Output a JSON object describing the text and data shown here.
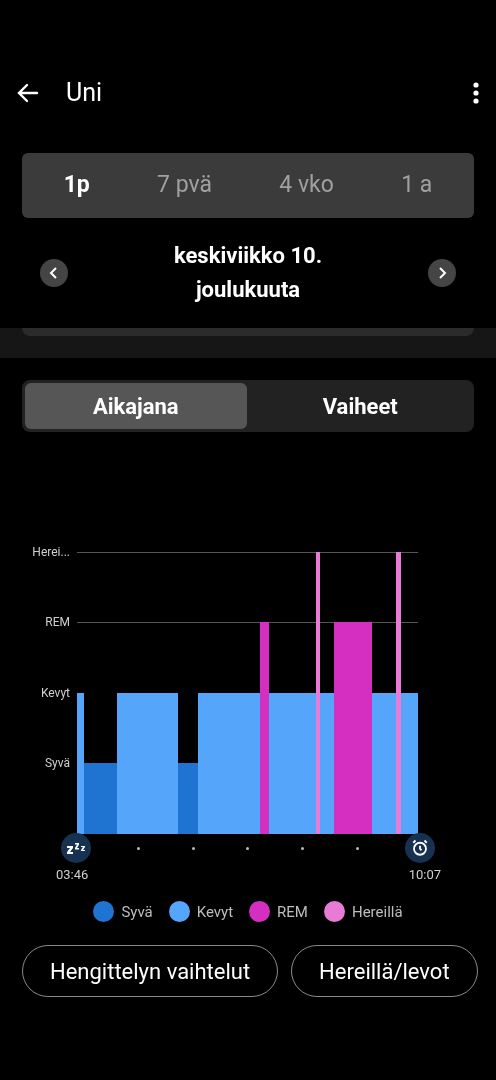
{
  "header": {
    "title": "Uni"
  },
  "periods": [
    {
      "label": "1p",
      "selected": true
    },
    {
      "label": "7 pvä",
      "selected": false
    },
    {
      "label": "4 vko",
      "selected": false
    },
    {
      "label": "1 a",
      "selected": false
    }
  ],
  "date": "keskiviikko 10. joulukuuta",
  "views": [
    {
      "label": "Aikajana",
      "selected": true
    },
    {
      "label": "Vaiheet",
      "selected": false
    }
  ],
  "chart": {
    "stages": [
      "Herei...",
      "REM",
      "Kevyt",
      "Syvä"
    ],
    "start": "03:46",
    "end": "10:07"
  },
  "legend": [
    {
      "label": "Syvä",
      "color": "#1f74d2"
    },
    {
      "label": "Kevyt",
      "color": "#55a6fb"
    },
    {
      "label": "REM",
      "color": "#d52fc2"
    },
    {
      "label": "Hereillä",
      "color": "#e87bd6"
    }
  ],
  "chips": [
    "Hengittelyn vaihtelut",
    "Hereillä/levot"
  ]
}
